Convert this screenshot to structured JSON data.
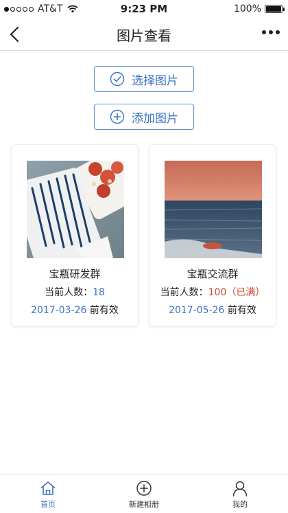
{
  "status_bar": {
    "carrier": "AT&T",
    "time": "9:23 PM",
    "battery": "100%"
  },
  "navbar": {
    "title": "图片查看",
    "back_icon": "chevron-left-icon",
    "more_icon": "more-horizontal-icon"
  },
  "actions": {
    "select_label": "选择图片",
    "add_label": "添加图片"
  },
  "groups": [
    {
      "name": "宝瓶研发群",
      "members_label": "当前人数：",
      "members_count": "18",
      "expiry_date": "2017-03-26",
      "expiry_suffix": " 前有效"
    },
    {
      "name": "宝瓶交流群",
      "members_label": "当前人数：",
      "members_count": "100（已满）",
      "expiry_date": "2017-05-26",
      "expiry_suffix": " 前有效"
    }
  ],
  "tabbar": {
    "items": [
      {
        "label": "首页",
        "icon": "home-icon",
        "active": true
      },
      {
        "label": "新建相册",
        "icon": "plus-circle-icon",
        "active": false
      },
      {
        "label": "我的",
        "icon": "user-icon",
        "active": false
      }
    ]
  },
  "colors": {
    "accent": "#3a73c4",
    "full": "#d04a2f"
  }
}
